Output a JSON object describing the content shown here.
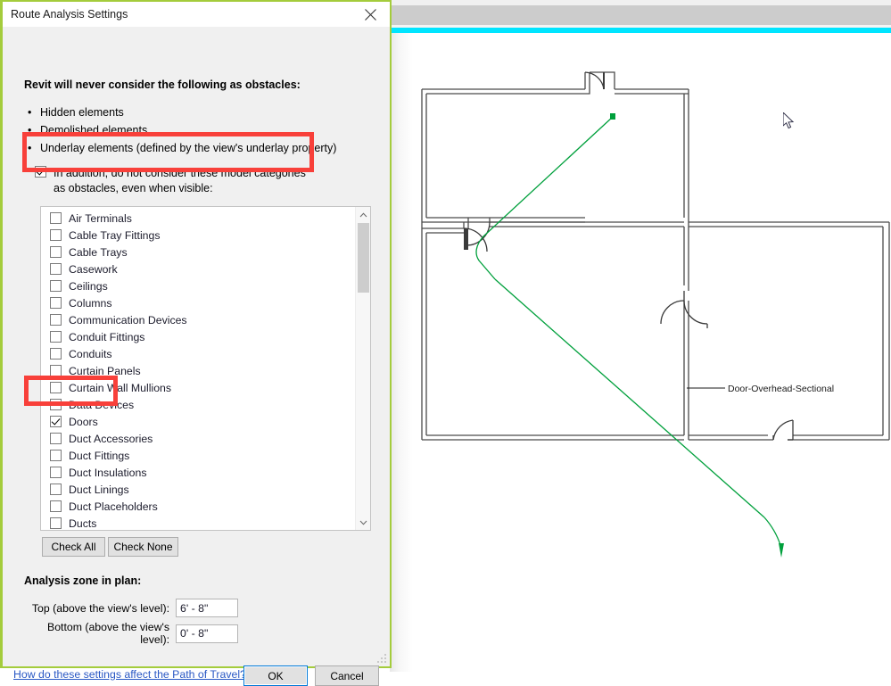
{
  "dialog": {
    "title": "Route Analysis Settings",
    "close_icon": "close-icon",
    "intro_heading": "Revit will never consider the following as obstacles:",
    "bullets": [
      "Hidden elements",
      "Demolished elements",
      "Underlay elements (defined by the view's underlay property)"
    ],
    "addition_checkbox": {
      "checked": true,
      "label": "In addition, do not consider these model categories as obstacles, even when visible:"
    },
    "categories": [
      {
        "label": "Air Terminals",
        "checked": false
      },
      {
        "label": "Cable Tray Fittings",
        "checked": false
      },
      {
        "label": "Cable Trays",
        "checked": false
      },
      {
        "label": "Casework",
        "checked": false
      },
      {
        "label": "Ceilings",
        "checked": false
      },
      {
        "label": "Columns",
        "checked": false
      },
      {
        "label": "Communication Devices",
        "checked": false
      },
      {
        "label": "Conduit Fittings",
        "checked": false
      },
      {
        "label": "Conduits",
        "checked": false
      },
      {
        "label": "Curtain Panels",
        "checked": false
      },
      {
        "label": "Curtain Wall Mullions",
        "checked": false
      },
      {
        "label": "Data Devices",
        "checked": false
      },
      {
        "label": "Doors",
        "checked": true
      },
      {
        "label": "Duct Accessories",
        "checked": false
      },
      {
        "label": "Duct Fittings",
        "checked": false
      },
      {
        "label": "Duct Insulations",
        "checked": false
      },
      {
        "label": "Duct Linings",
        "checked": false
      },
      {
        "label": "Duct Placeholders",
        "checked": false
      },
      {
        "label": "Ducts",
        "checked": false
      }
    ],
    "buttons": {
      "check_all": "Check All",
      "check_none": "Check None",
      "ok": "OK",
      "cancel": "Cancel"
    },
    "zone": {
      "heading": "Analysis zone in plan:",
      "top_label": "Top (above the view's level):",
      "top_value": "6' - 8\"",
      "bottom_label": "Bottom (above the view's level):",
      "bottom_value": "0' - 8\""
    },
    "help_link": "How do these settings affect the Path of Travel?",
    "scrollbar": {
      "up_icon": "chevron-up-icon",
      "down_icon": "chevron-down-icon"
    }
  },
  "canvas": {
    "door_tag_label": "Door-Overhead-Sectional",
    "path_color": "#00a03c",
    "accent_cyan": "#00e5ff",
    "cursor_icon": "mouse-pointer-icon"
  },
  "annotations": {
    "highlight_color": "#f8403a",
    "boxes": [
      "addition-checkbox-highlight",
      "doors-row-highlight"
    ]
  }
}
